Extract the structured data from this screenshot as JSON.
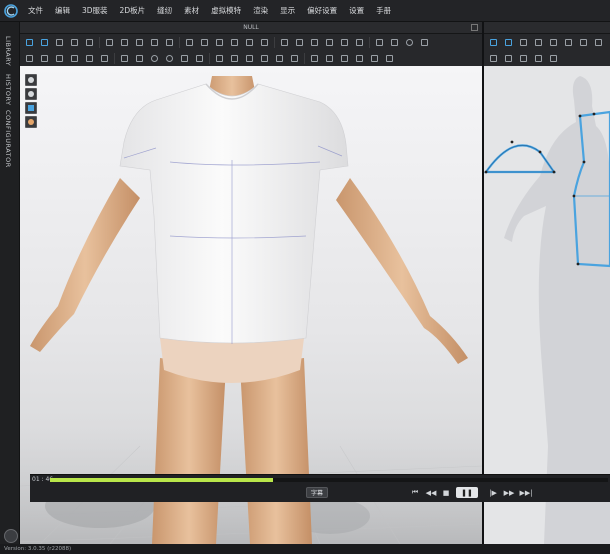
{
  "menu": {
    "items": [
      "文件",
      "编辑",
      "3D服装",
      "2D板片",
      "缝纫",
      "素材",
      "虚拟模特",
      "渲染",
      "显示",
      "偏好设置",
      "设置",
      "手册"
    ]
  },
  "side_tabs": [
    "LIBRARY",
    "HISTORY",
    "CONFIGURATOR"
  ],
  "window3d": {
    "title": "NULL"
  },
  "playback": {
    "timecode": "01 : 46",
    "progress": 0.4,
    "subtitle_label": "字幕",
    "first_icon": "⏮",
    "rewind_icon": "◀◀",
    "stop_icon": "■",
    "pause_icon": "❚❚",
    "step_icon": "|▶",
    "forward_icon": "▶▶",
    "last_icon": "▶▶|"
  },
  "status": {
    "version": "Version: 3.0.35    (r22088)"
  },
  "colors": {
    "accent": "#4aa3df",
    "progress": "#b9e64a",
    "garment": "#f6f6f6",
    "skin": "#e3b994"
  }
}
